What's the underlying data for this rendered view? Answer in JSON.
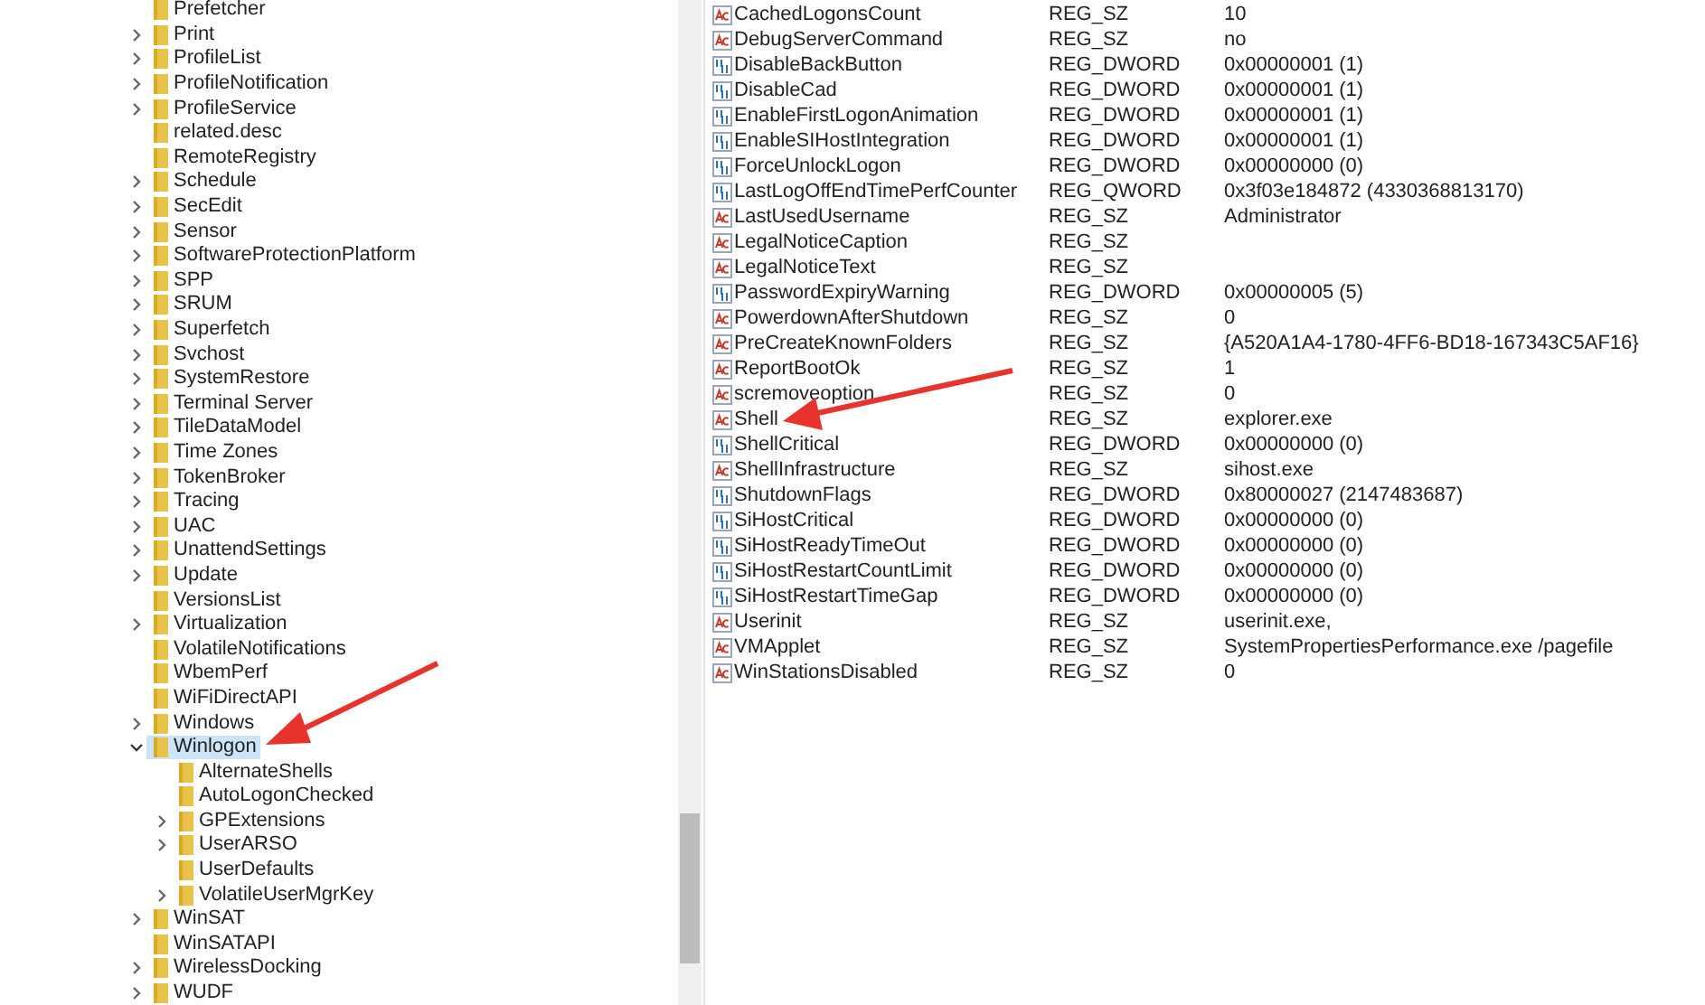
{
  "tree": [
    {
      "label": "Prefetcher",
      "expandable": false,
      "selected": false
    },
    {
      "label": "Print",
      "expandable": true,
      "expanded": false,
      "selected": false
    },
    {
      "label": "ProfileList",
      "expandable": true,
      "expanded": false,
      "selected": false
    },
    {
      "label": "ProfileNotification",
      "expandable": true,
      "expanded": false,
      "selected": false
    },
    {
      "label": "ProfileService",
      "expandable": true,
      "expanded": false,
      "selected": false
    },
    {
      "label": "related.desc",
      "expandable": false,
      "selected": false
    },
    {
      "label": "RemoteRegistry",
      "expandable": false,
      "selected": false
    },
    {
      "label": "Schedule",
      "expandable": true,
      "expanded": false,
      "selected": false
    },
    {
      "label": "SecEdit",
      "expandable": true,
      "expanded": false,
      "selected": false
    },
    {
      "label": "Sensor",
      "expandable": true,
      "expanded": false,
      "selected": false
    },
    {
      "label": "SoftwareProtectionPlatform",
      "expandable": true,
      "expanded": false,
      "selected": false
    },
    {
      "label": "SPP",
      "expandable": true,
      "expanded": false,
      "selected": false
    },
    {
      "label": "SRUM",
      "expandable": true,
      "expanded": false,
      "selected": false
    },
    {
      "label": "Superfetch",
      "expandable": true,
      "expanded": false,
      "selected": false
    },
    {
      "label": "Svchost",
      "expandable": true,
      "expanded": false,
      "selected": false
    },
    {
      "label": "SystemRestore",
      "expandable": true,
      "expanded": false,
      "selected": false
    },
    {
      "label": "Terminal Server",
      "expandable": true,
      "expanded": false,
      "selected": false
    },
    {
      "label": "TileDataModel",
      "expandable": true,
      "expanded": false,
      "selected": false
    },
    {
      "label": "Time Zones",
      "expandable": true,
      "expanded": false,
      "selected": false
    },
    {
      "label": "TokenBroker",
      "expandable": true,
      "expanded": false,
      "selected": false
    },
    {
      "label": "Tracing",
      "expandable": true,
      "expanded": false,
      "selected": false
    },
    {
      "label": "UAC",
      "expandable": true,
      "expanded": false,
      "selected": false
    },
    {
      "label": "UnattendSettings",
      "expandable": true,
      "expanded": false,
      "selected": false
    },
    {
      "label": "Update",
      "expandable": true,
      "expanded": false,
      "selected": false
    },
    {
      "label": "VersionsList",
      "expandable": false,
      "selected": false
    },
    {
      "label": "Virtualization",
      "expandable": true,
      "expanded": false,
      "selected": false
    },
    {
      "label": "VolatileNotifications",
      "expandable": false,
      "selected": false
    },
    {
      "label": "WbemPerf",
      "expandable": false,
      "selected": false
    },
    {
      "label": "WiFiDirectAPI",
      "expandable": false,
      "selected": false
    },
    {
      "label": "Windows",
      "expandable": true,
      "expanded": false,
      "selected": false
    },
    {
      "label": "Winlogon",
      "expandable": true,
      "expanded": true,
      "selected": true,
      "children": [
        {
          "label": "AlternateShells",
          "expandable": false,
          "selected": false
        },
        {
          "label": "AutoLogonChecked",
          "expandable": false,
          "selected": false
        },
        {
          "label": "GPExtensions",
          "expandable": true,
          "expanded": false,
          "selected": false
        },
        {
          "label": "UserARSO",
          "expandable": true,
          "expanded": false,
          "selected": false
        },
        {
          "label": "UserDefaults",
          "expandable": false,
          "selected": false
        },
        {
          "label": "VolatileUserMgrKey",
          "expandable": true,
          "expanded": false,
          "selected": false
        }
      ]
    },
    {
      "label": "WinSAT",
      "expandable": true,
      "expanded": false,
      "selected": false
    },
    {
      "label": "WinSATAPI",
      "expandable": false,
      "selected": false
    },
    {
      "label": "WirelessDocking",
      "expandable": true,
      "expanded": false,
      "selected": false
    },
    {
      "label": "WUDF",
      "expandable": true,
      "expanded": false,
      "selected": false
    }
  ],
  "values": [
    {
      "kind": "string",
      "name": "CachedLogonsCount",
      "type": "REG_SZ",
      "data": "10"
    },
    {
      "kind": "string",
      "name": "DebugServerCommand",
      "type": "REG_SZ",
      "data": "no"
    },
    {
      "kind": "binary",
      "name": "DisableBackButton",
      "type": "REG_DWORD",
      "data": "0x00000001 (1)"
    },
    {
      "kind": "binary",
      "name": "DisableCad",
      "type": "REG_DWORD",
      "data": "0x00000001 (1)"
    },
    {
      "kind": "binary",
      "name": "EnableFirstLogonAnimation",
      "type": "REG_DWORD",
      "data": "0x00000001 (1)"
    },
    {
      "kind": "binary",
      "name": "EnableSIHostIntegration",
      "type": "REG_DWORD",
      "data": "0x00000001 (1)"
    },
    {
      "kind": "binary",
      "name": "ForceUnlockLogon",
      "type": "REG_DWORD",
      "data": "0x00000000 (0)"
    },
    {
      "kind": "binary",
      "name": "LastLogOffEndTimePerfCounter",
      "type": "REG_QWORD",
      "data": "0x3f03e184872 (4330368813170)"
    },
    {
      "kind": "string",
      "name": "LastUsedUsername",
      "type": "REG_SZ",
      "data": "Administrator"
    },
    {
      "kind": "string",
      "name": "LegalNoticeCaption",
      "type": "REG_SZ"
    },
    {
      "kind": "string",
      "name": "LegalNoticeText",
      "type": "REG_SZ"
    },
    {
      "kind": "binary",
      "name": "PasswordExpiryWarning",
      "type": "REG_DWORD",
      "data": "0x00000005 (5)"
    },
    {
      "kind": "string",
      "name": "PowerdownAfterShutdown",
      "type": "REG_SZ",
      "data": "0"
    },
    {
      "kind": "string",
      "name": "PreCreateKnownFolders",
      "type": "REG_SZ",
      "data": "{A520A1A4-1780-4FF6-BD18-167343C5AF16}"
    },
    {
      "kind": "string",
      "name": "ReportBootOk",
      "type": "REG_SZ",
      "data": "1"
    },
    {
      "kind": "string",
      "name": "scremoveoption",
      "type": "REG_SZ",
      "data": "0"
    },
    {
      "kind": "string",
      "name": "Shell",
      "type": "REG_SZ",
      "data": "explorer.exe"
    },
    {
      "kind": "binary",
      "name": "ShellCritical",
      "type": "REG_DWORD",
      "data": "0x00000000 (0)"
    },
    {
      "kind": "string",
      "name": "ShellInfrastructure",
      "type": "REG_SZ",
      "data": "sihost.exe"
    },
    {
      "kind": "binary",
      "name": "ShutdownFlags",
      "type": "REG_DWORD",
      "data": "0x80000027 (2147483687)"
    },
    {
      "kind": "binary",
      "name": "SiHostCritical",
      "type": "REG_DWORD",
      "data": "0x00000000 (0)"
    },
    {
      "kind": "binary",
      "name": "SiHostReadyTimeOut",
      "type": "REG_DWORD",
      "data": "0x00000000 (0)"
    },
    {
      "kind": "binary",
      "name": "SiHostRestartCountLimit",
      "type": "REG_DWORD",
      "data": "0x00000000 (0)"
    },
    {
      "kind": "binary",
      "name": "SiHostRestartTimeGap",
      "type": "REG_DWORD",
      "data": "0x00000000 (0)"
    },
    {
      "kind": "string",
      "name": "Userinit",
      "type": "REG_SZ",
      "data": "userinit.exe,"
    },
    {
      "kind": "string",
      "name": "VMApplet",
      "type": "REG_SZ",
      "data": "SystemPropertiesPerformance.exe /pagefile"
    },
    {
      "kind": "string",
      "name": "WinStationsDisabled",
      "type": "REG_SZ",
      "data": "0"
    }
  ]
}
